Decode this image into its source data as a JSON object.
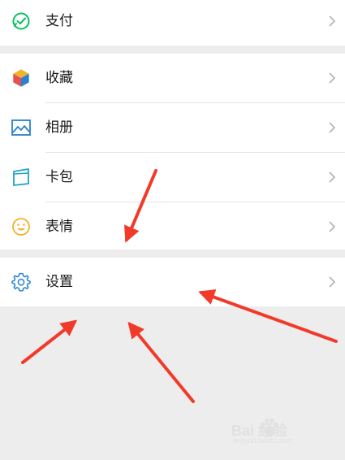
{
  "menu": {
    "pay": {
      "label": "支付",
      "icon": "wechat-pay-icon"
    },
    "favorites": {
      "label": "收藏",
      "icon": "favorites-cube-icon"
    },
    "album": {
      "label": "相册",
      "icon": "album-picture-icon"
    },
    "cards": {
      "label": "卡包",
      "icon": "card-wallet-icon"
    },
    "stickers": {
      "label": "表情",
      "icon": "sticker-smile-icon"
    },
    "settings": {
      "label": "设置",
      "icon": "settings-gear-icon"
    }
  },
  "watermark": {
    "text": "Bai 经验",
    "sub": "jingyan.baidu.com"
  },
  "colors": {
    "background": "#ededed",
    "row": "#ffffff",
    "arrow": "#f23a2a",
    "pay_green": "#07c160",
    "album_blue": "#2b7fcf",
    "card_teal": "#1fa2c8",
    "sticker_yellow": "#f2b32a",
    "settings_blue": "#2f87d6"
  }
}
